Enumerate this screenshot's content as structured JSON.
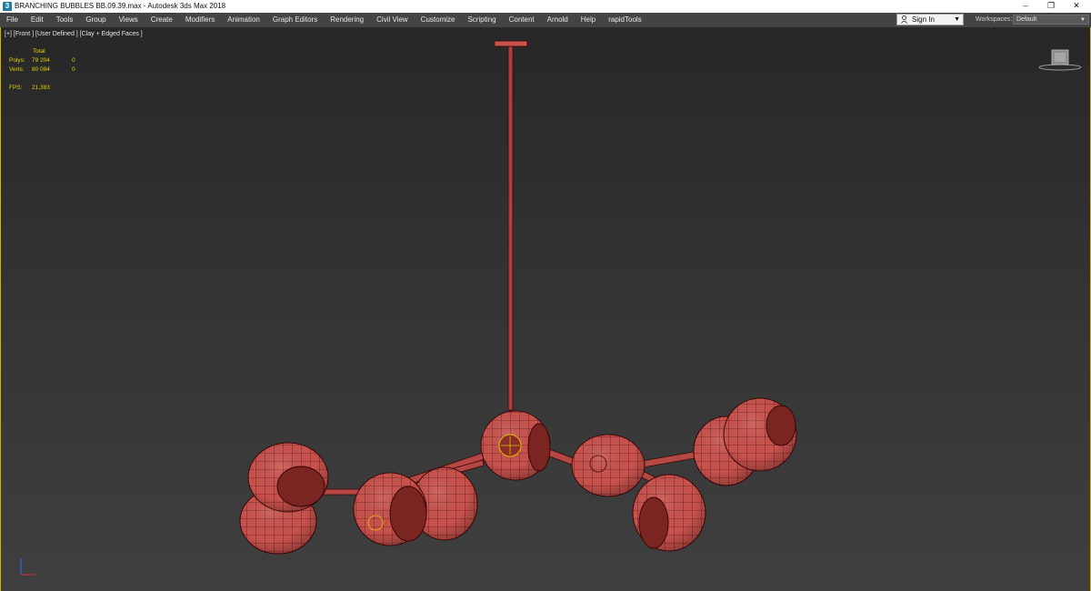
{
  "window": {
    "title": "BRANCHING BUBBLES BB.09.39.max - Autodesk 3ds Max 2018",
    "app_icon_label": "3",
    "minimize": "–",
    "restore": "❐",
    "close": "✕"
  },
  "menu": {
    "items": [
      "File",
      "Edit",
      "Tools",
      "Group",
      "Views",
      "Create",
      "Modifiers",
      "Animation",
      "Graph Editors",
      "Rendering",
      "Civil View",
      "Customize",
      "Scripting",
      "Content",
      "Arnold",
      "Help",
      "rapidTools"
    ],
    "sign_in": "Sign In",
    "workspaces_label": "Workspaces:",
    "workspaces_value": "Default"
  },
  "viewport": {
    "label": "[+] [Front ] [User Defined ] [Clay + Edged Faces ]",
    "stats": {
      "header": "Total",
      "polys_label": "Polys:",
      "polys_value": "79 204",
      "polys_sel": "0",
      "verts_label": "Verts:",
      "verts_value": "80 084",
      "verts_sel": "0",
      "fps_label": "FPS:",
      "fps_value": "21,383"
    }
  },
  "colors": {
    "model": "#c8524d",
    "model_dark": "#6a1a18",
    "wire": "#3a0606",
    "highlight": "#e0c000"
  },
  "icons": [
    "app-icon",
    "user-icon",
    "chevron-down-icon",
    "viewcube-icon",
    "axis-gizmo-icon"
  ]
}
